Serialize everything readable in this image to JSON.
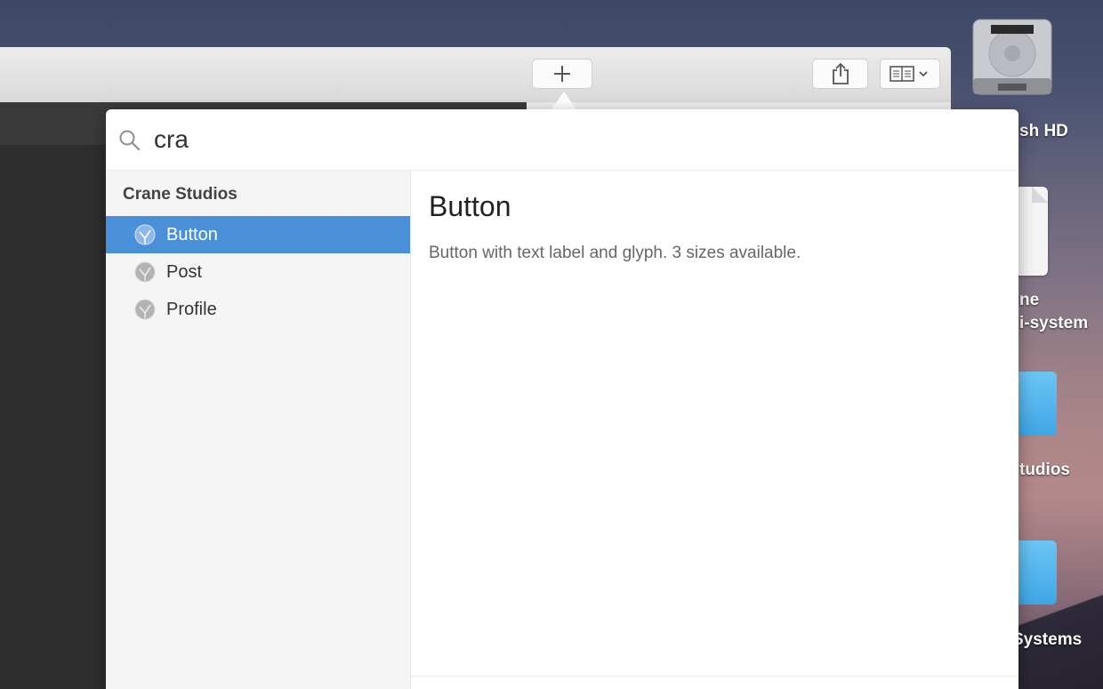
{
  "desktop": {
    "icons": [
      {
        "label": "sh HD",
        "icon": "hard-disk-icon"
      },
      {
        "label_line1": "ne",
        "label_line2": "i-system",
        "icon": "document-icon"
      },
      {
        "label": "tudios",
        "icon": "folder-icon"
      },
      {
        "label": "Systems",
        "icon": "folder-icon"
      }
    ]
  },
  "toolbar": {
    "add_icon": "plus-icon",
    "share_icon": "share-icon",
    "reader_icon": "reader-view-icon"
  },
  "popover": {
    "search": {
      "value": "cra",
      "icon": "search-icon"
    },
    "sidebar": {
      "group_title": "Crane Studios",
      "items": [
        {
          "label": "Button",
          "selected": true,
          "icon": "component-icon"
        },
        {
          "label": "Post",
          "selected": false,
          "icon": "component-icon"
        },
        {
          "label": "Profile",
          "selected": false,
          "icon": "component-icon"
        }
      ]
    },
    "detail": {
      "title": "Button",
      "description": "Button with text label and glyph. 3 sizes available."
    }
  },
  "colors": {
    "selection": "#4a90d9",
    "caret": "#2f7fd6"
  }
}
